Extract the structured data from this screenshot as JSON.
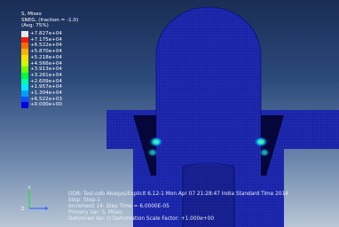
{
  "legend": {
    "title": "S, Mises",
    "snegline": "SNEG, (fraction = -1.0)",
    "avg": "(Avg: 75%)",
    "entries": [
      {
        "value": "+7.827e+04",
        "color": "#e8e8e8"
      },
      {
        "value": "+7.175e+04",
        "color": "#ff1a00"
      },
      {
        "value": "+6.522e+04",
        "color": "#ff6a00"
      },
      {
        "value": "+5.870e+04",
        "color": "#ffb300"
      },
      {
        "value": "+5.218e+04",
        "color": "#ffe000"
      },
      {
        "value": "+4.566e+04",
        "color": "#c8ff00"
      },
      {
        "value": "+3.913e+04",
        "color": "#6cff00"
      },
      {
        "value": "+3.261e+04",
        "color": "#00ff3a"
      },
      {
        "value": "+2.609e+04",
        "color": "#00ffa8"
      },
      {
        "value": "+1.957e+04",
        "color": "#00e8ff"
      },
      {
        "value": "+1.304e+04",
        "color": "#009dff"
      },
      {
        "value": "+6.522e+03",
        "color": "#0052ff"
      },
      {
        "value": "+0.000e+00",
        "color": "#0000e0"
      }
    ]
  },
  "info": {
    "line1": "ODB: Test.odb    Abaqus/Explicit 6.12-1    Mon Apr 07 21:28:47 India Standard Time 2014",
    "line2": "Step: Step-1",
    "line3": "Increment      14: Step Time =   6.0000E-05",
    "line4": "Primary Var: S, Mises",
    "line5": "Deformed Var: U   Deformation Scale Factor: +1.000e+00"
  },
  "triad": {
    "y": "Y",
    "z": "Z",
    "x": "X"
  },
  "colors": {
    "mesh_blue": "#1f2ab4",
    "mesh_lines": "#0a1170",
    "bg_top": "#1a2d55",
    "bg_bottom": "#b9c6d6"
  }
}
